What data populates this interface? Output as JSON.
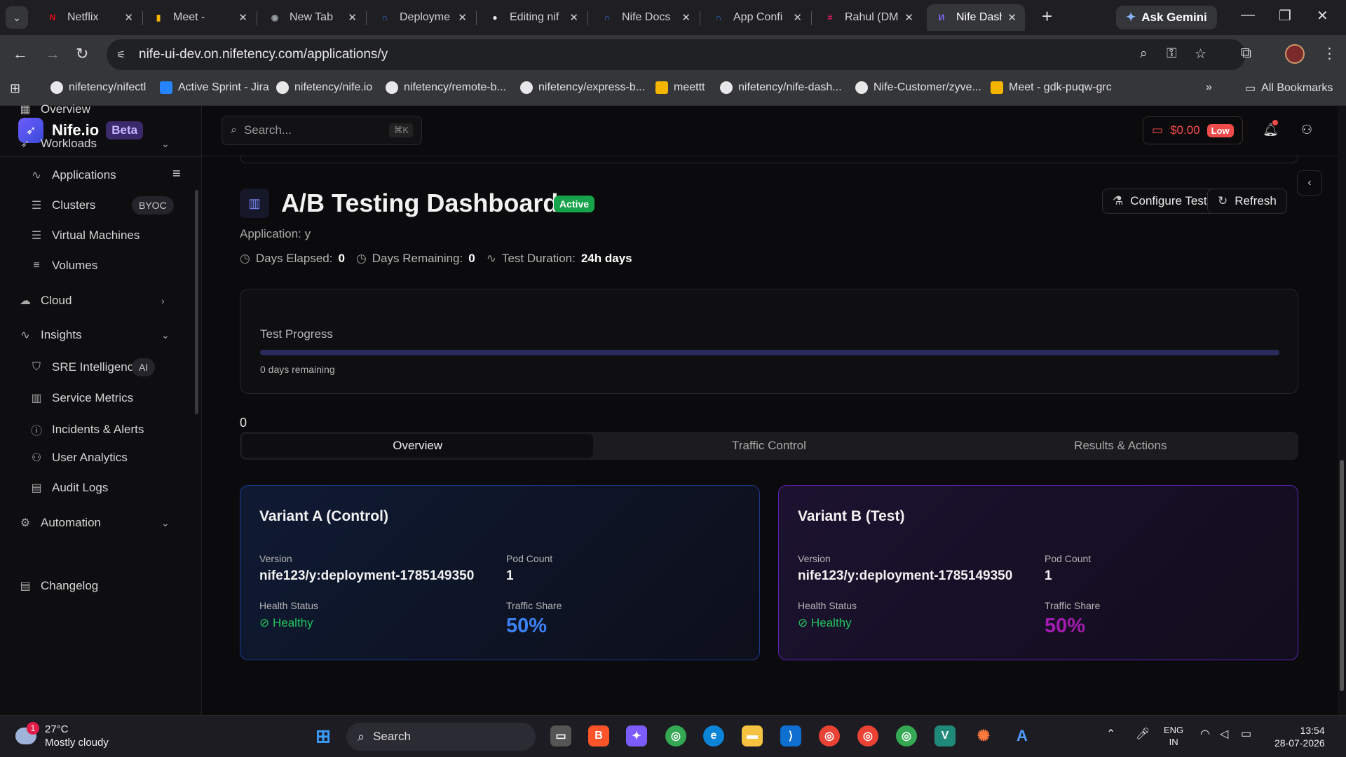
{
  "browser": {
    "tabs": [
      {
        "label": "Netflix",
        "fav": "N",
        "fav_color": "#e50914",
        "active": false
      },
      {
        "label": "Meet -",
        "fav": "▮",
        "fav_color": "#f4b400",
        "active": false
      },
      {
        "label": "New Tab",
        "fav": "◉",
        "fav_color": "#9aa0a6",
        "active": false
      },
      {
        "label": "Deployme",
        "fav": "∩",
        "fav_color": "#2b7de9",
        "active": false
      },
      {
        "label": "Editing nif",
        "fav": "●",
        "fav_color": "#e8e8e8",
        "active": false
      },
      {
        "label": "Nife Docs",
        "fav": "∩",
        "fav_color": "#2b7de9",
        "active": false
      },
      {
        "label": "App Confi",
        "fav": "∩",
        "fav_color": "#2b7de9",
        "active": false
      },
      {
        "label": "Rahul (DM",
        "fav": "#",
        "fav_color": "#e01e5a",
        "active": false
      },
      {
        "label": "Nife Dashl",
        "fav": "И",
        "fav_color": "#7c6cff",
        "active": true
      }
    ],
    "ask_gemini": "Ask Gemini",
    "url": "nife-ui-dev.on.nifetency.com/applications/y",
    "bookmarks": [
      {
        "label": "nifetency/nifectl",
        "kind": "github"
      },
      {
        "label": "Active Sprint - Jira",
        "kind": "jira"
      },
      {
        "label": "nifetency/nife.io",
        "kind": "github"
      },
      {
        "label": "nifetency/remote-b...",
        "kind": "github"
      },
      {
        "label": "nifetency/express-b...",
        "kind": "github"
      },
      {
        "label": "meettt",
        "kind": "meet"
      },
      {
        "label": "nifetency/nife-dash...",
        "kind": "github"
      },
      {
        "label": "Nife-Customer/zyve...",
        "kind": "github"
      },
      {
        "label": "Meet - gdk-puqw-grc",
        "kind": "meet"
      }
    ],
    "all_bookmarks": "All Bookmarks",
    "overflow": "»"
  },
  "sidebar": {
    "brand": "Nife.io",
    "beta": "Beta",
    "items": [
      {
        "label": "Overview",
        "icon": "grid-icon",
        "glyph": "▦"
      },
      {
        "label": "Workloads",
        "icon": "rocket-icon",
        "glyph": "➶",
        "chev": "⌄"
      },
      {
        "label": "Applications",
        "icon": "activity-icon",
        "glyph": "∿"
      },
      {
        "label": "Clusters",
        "icon": "server-icon",
        "glyph": "☰",
        "badge": "BYOC"
      },
      {
        "label": "Virtual Machines",
        "icon": "server-icon",
        "glyph": "☰"
      },
      {
        "label": "Volumes",
        "icon": "database-icon",
        "glyph": "≡"
      },
      {
        "label": "Cloud",
        "icon": "cloud-icon",
        "glyph": "☁",
        "chev": "›"
      },
      {
        "label": "Insights",
        "icon": "activity-icon",
        "glyph": "∿",
        "chev": "⌄"
      },
      {
        "label": "SRE Intelligence",
        "icon": "shield-icon",
        "glyph": "⛉",
        "badge": "AI"
      },
      {
        "label": "Service Metrics",
        "icon": "bar-chart-icon",
        "glyph": "▥"
      },
      {
        "label": "Incidents & Alerts",
        "icon": "alert-icon",
        "glyph": "ⓘ"
      },
      {
        "label": "User Analytics",
        "icon": "users-icon",
        "glyph": "⚇"
      },
      {
        "label": "Audit Logs",
        "icon": "file-icon",
        "glyph": "▤"
      },
      {
        "label": "Automation",
        "icon": "gear-icon",
        "glyph": "⚙",
        "chev": "⌄"
      },
      {
        "label": "Changelog",
        "icon": "changelog-icon",
        "glyph": "▤"
      }
    ]
  },
  "topbar": {
    "search_placeholder": "Search...",
    "shortcut": "⌘K",
    "credit": "$0.00",
    "credit_status": "Low"
  },
  "page": {
    "title": "A/B Testing Dashboard",
    "status": "Active",
    "configure_label": "Configure Test",
    "refresh_label": "Refresh",
    "application_line": "Application: y",
    "days_elapsed_label": "Days Elapsed:",
    "days_elapsed": "0",
    "days_remaining_label": "Days Remaining:",
    "days_remaining": "0",
    "duration_label": "Test Duration:",
    "duration": "24h days",
    "progress_label": "Test Progress",
    "progress_fraction": 0.0,
    "progress_note": "0 days remaining",
    "stray_value": "0",
    "tabs": [
      "Overview",
      "Traffic Control",
      "Results & Actions"
    ],
    "active_tab": 0
  },
  "variants": [
    {
      "title": "Variant A (Control)",
      "version_label": "Version",
      "version": "nife123/y:deployment-1785149350",
      "pod_label": "Pod Count",
      "pods": "1",
      "health_label": "Health Status",
      "health": "Healthy",
      "share_label": "Traffic Share",
      "share": "50%",
      "accent": "#3b82f6"
    },
    {
      "title": "Variant B (Test)",
      "version_label": "Version",
      "version": "nife123/y:deployment-1785149350",
      "pod_label": "Pod Count",
      "pods": "1",
      "health_label": "Health Status",
      "health": "Healthy",
      "share_label": "Traffic Share",
      "share": "50%",
      "accent": "#a21caf"
    }
  ],
  "taskbar": {
    "weather_temp": "27°C",
    "weather_desc": "Mostly cloudy",
    "weather_badge": "1",
    "search": "Search",
    "lang1": "ENG",
    "lang2": "IN",
    "time": "13:54",
    "date": "28-07-2026"
  }
}
